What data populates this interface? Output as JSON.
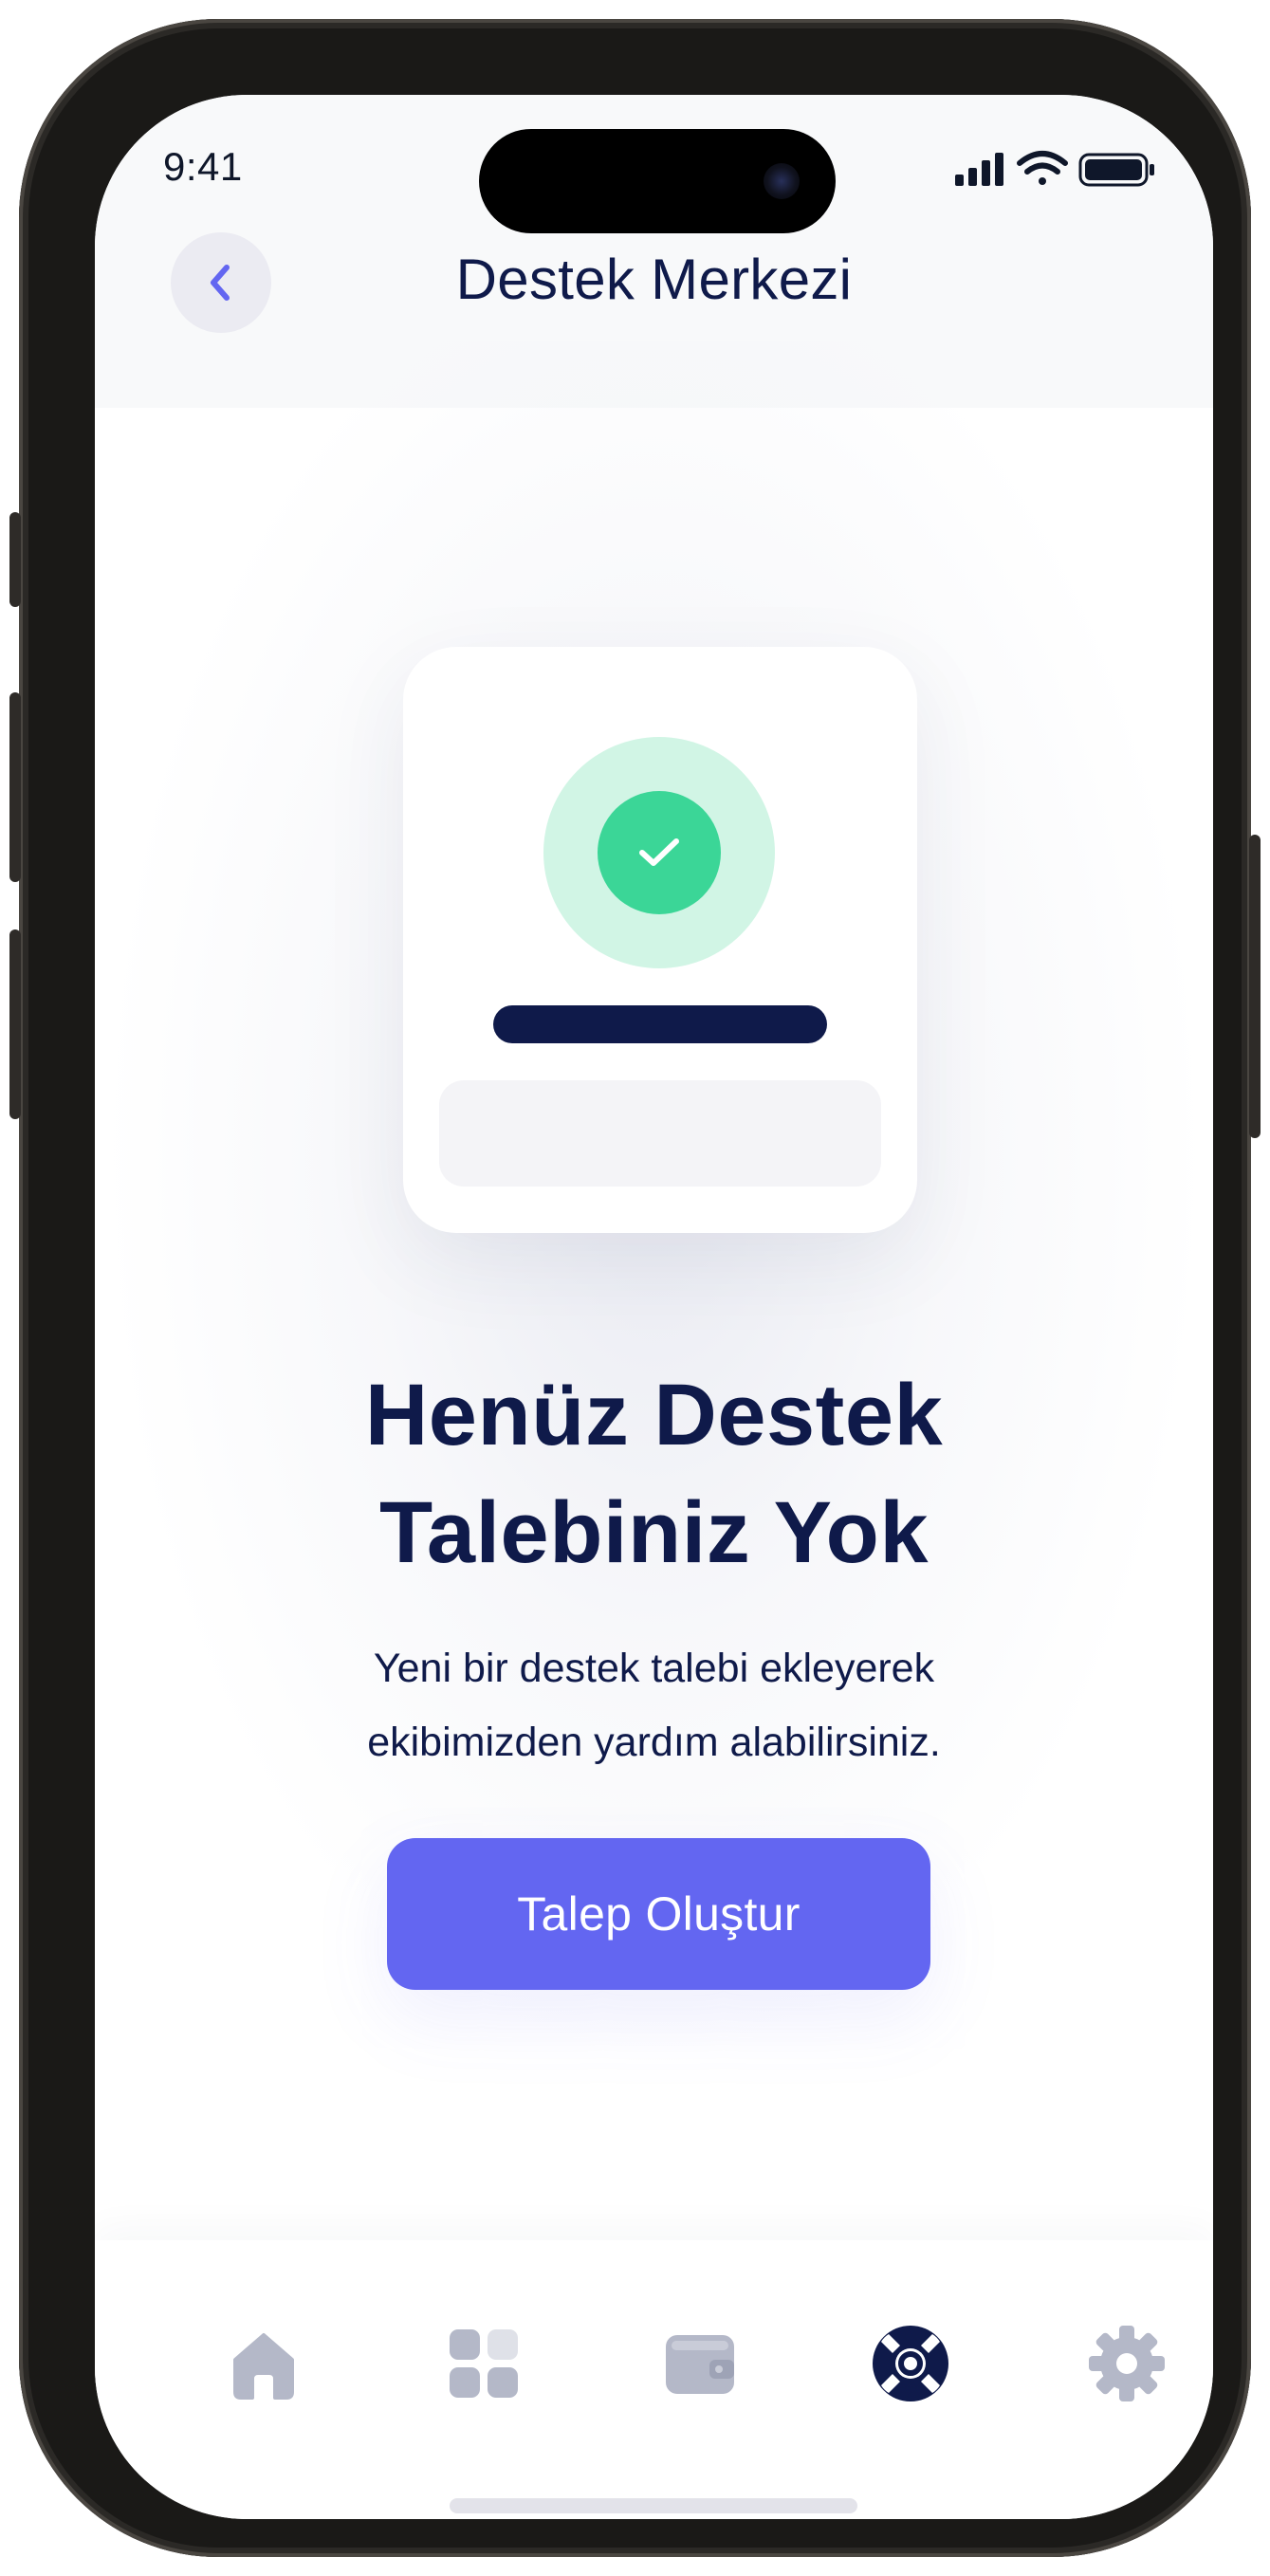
{
  "status_bar": {
    "time": "9:41"
  },
  "header": {
    "title": "Destek Merkezi",
    "back_icon": "chevron-left-icon"
  },
  "empty_state": {
    "title": "Henüz Destek Talebiniz Yok",
    "description": "Yeni bir destek talebi ekleyerek ekibimizden yardım alabilirsiniz.",
    "illustration_icon": "check-icon"
  },
  "cta_button": {
    "label": "Talep Oluştur"
  },
  "tab_bar": {
    "items": [
      {
        "icon": "home-icon",
        "active": false
      },
      {
        "icon": "grid-icon",
        "active": false
      },
      {
        "icon": "wallet-icon",
        "active": false
      },
      {
        "icon": "lifebuoy-icon",
        "active": true
      },
      {
        "icon": "gear-icon",
        "active": false
      }
    ]
  },
  "colors": {
    "primary": "#6366f1",
    "navy": "#0f1a4a",
    "success": "#3bd697",
    "success_soft": "#d1f5e5",
    "inactive_icon": "#b4b8c8"
  }
}
